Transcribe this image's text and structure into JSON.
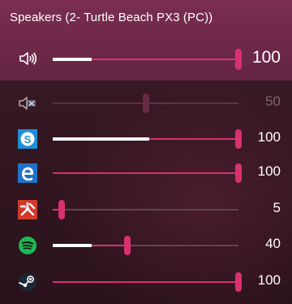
{
  "title": "Speakers (2- Turtle Beach PX3 (PC))",
  "colors": {
    "accent": "#d8316f",
    "header_bg": "#6d2847",
    "track_bg": "#5e4651",
    "level": "#ffffff"
  },
  "master": {
    "icon": "speaker-icon",
    "volume": 100,
    "volume_label": "100",
    "peak_level": 0.21
  },
  "apps": [
    {
      "icon": "system-sounds-muted-icon",
      "volume": 50,
      "volume_label": "50",
      "muted": true,
      "peak_level": 0
    },
    {
      "icon": "skype-icon",
      "volume": 100,
      "volume_label": "100",
      "muted": false,
      "peak_level": 0.52
    },
    {
      "icon": "edge-icon",
      "volume": 100,
      "volume_label": "100",
      "muted": false,
      "peak_level": 0
    },
    {
      "icon": "app-red-icon",
      "volume": 5,
      "volume_label": "5",
      "muted": false,
      "peak_level": 0
    },
    {
      "icon": "spotify-icon",
      "volume": 40,
      "volume_label": "40",
      "muted": false,
      "peak_level": 0.21
    },
    {
      "icon": "steam-icon",
      "volume": 100,
      "volume_label": "100",
      "muted": false,
      "peak_level": 0
    }
  ]
}
